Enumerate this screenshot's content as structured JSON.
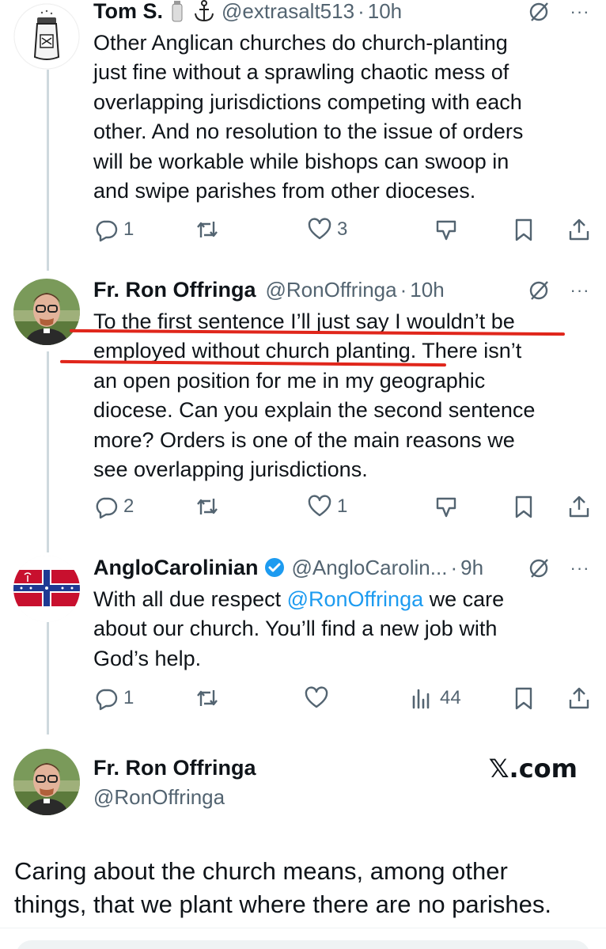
{
  "tweets": [
    {
      "name": "Tom S.",
      "handle": "@extrasalt513",
      "dot": "·",
      "time": "10h",
      "lines": [
        "Other Anglican churches do church-planting",
        "just fine without a sprawling chaotic mess of",
        "overlapping jurisdictions competing with each",
        "other. And no resolution to the issue of orders",
        "will be workable while bishops can swoop in",
        "and swipe parishes from other dioceses."
      ],
      "replies": "1",
      "retweets": "",
      "likes": "3"
    },
    {
      "name": "Fr. Ron Offringa",
      "handle": "@RonOffringa",
      "dot": "·",
      "time": "10h",
      "lines": [
        "To the first sentence I’ll just say I wouldn’t be",
        "employed without church planting. There isn’t",
        "an open position for me in my geographic",
        "diocese. Can you explain the second sentence",
        "more? Orders is one of the main reasons we",
        "see overlapping jurisdictions."
      ],
      "replies": "2",
      "retweets": "",
      "likes": "1"
    },
    {
      "name": "AngloCarolinian",
      "handle": "@AngloCarolin...",
      "dot": "·",
      "time": "9h",
      "line1_pre": "With all due respect ",
      "line1_mention": "@RonOffringa",
      "line1_post": " we care",
      "lines": [
        "about our church. You’ll find a new job with",
        "God’s help."
      ],
      "replies": "1",
      "retweets": "",
      "likes": "",
      "views": "44"
    }
  ],
  "card": {
    "name": "Fr. Ron Offringa",
    "handle": "@RonOffringa",
    "brand": "𝕏.com",
    "lines": [
      "Caring about the church means, among other",
      "things, that we plant where there are no parishes."
    ]
  },
  "colors": {
    "text": "#0f1419",
    "secondary": "#536471",
    "link": "#1d9bf0",
    "underline": "#e0261b",
    "verified": "#1d9bf0"
  },
  "icons": [
    "reply-icon",
    "retweet-icon",
    "like-icon",
    "grok-icon",
    "more-icon",
    "bookmark-icon",
    "share-icon",
    "views-icon",
    "verified-icon"
  ]
}
